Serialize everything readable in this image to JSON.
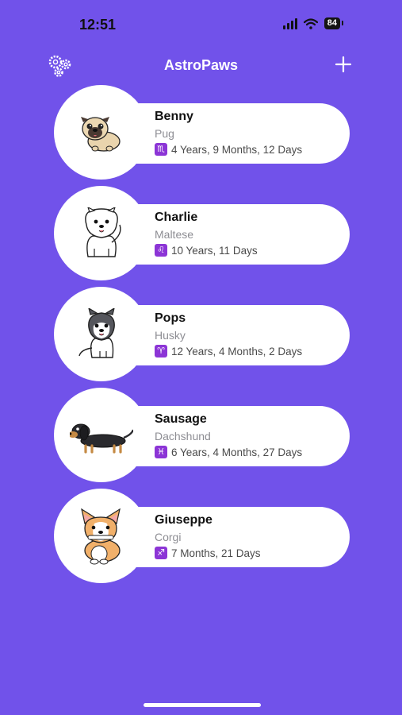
{
  "status_bar": {
    "time": "12:51",
    "battery": "84",
    "icons": [
      "signal-icon",
      "wifi-icon",
      "battery-icon"
    ]
  },
  "nav": {
    "title": "AstroPaws",
    "left_icon": "settings-gears-icon",
    "right_icon": "plus-icon"
  },
  "pets": [
    {
      "name": "Benny",
      "breed": "Pug",
      "zodiac_symbol": "♏",
      "zodiac_icon": "scorpio-icon",
      "age": "4 Years, 9 Months, 12 Days",
      "avatar": "pug-illustration"
    },
    {
      "name": "Charlie",
      "breed": "Maltese",
      "zodiac_symbol": "♌",
      "zodiac_icon": "leo-icon",
      "age": "10 Years, 11 Days",
      "avatar": "maltese-illustration"
    },
    {
      "name": "Pops",
      "breed": "Husky",
      "zodiac_symbol": "♈",
      "zodiac_icon": "aries-icon",
      "age": "12 Years, 4 Months, 2 Days",
      "avatar": "husky-illustration"
    },
    {
      "name": "Sausage",
      "breed": "Dachshund",
      "zodiac_symbol": "♓",
      "zodiac_icon": "pisces-icon",
      "age": "6 Years, 4 Months, 27 Days",
      "avatar": "dachshund-illustration"
    },
    {
      "name": "Giuseppe",
      "breed": "Corgi",
      "zodiac_symbol": "♐",
      "zodiac_icon": "sagittarius-icon",
      "age": "7 Months, 21 Days",
      "avatar": "corgi-illustration"
    }
  ],
  "colors": {
    "background": "#7152ea",
    "card": "#ffffff",
    "zodiac_badge": "#8c35d6",
    "subtitle": "#8d8d93"
  }
}
